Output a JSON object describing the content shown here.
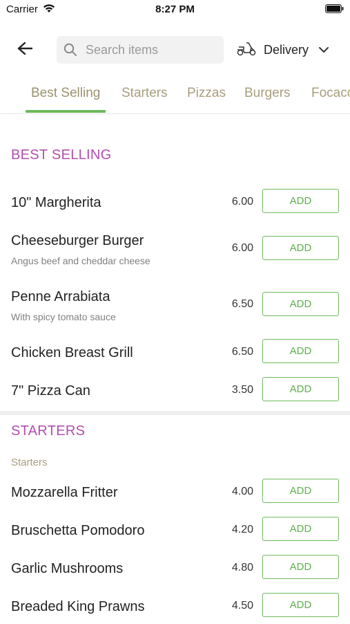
{
  "status_bar": {
    "carrier": "Carrier",
    "time": "8:27 PM"
  },
  "header": {
    "search_placeholder": "Search items",
    "delivery_label": "Delivery"
  },
  "tabs": [
    {
      "label": "Best Selling",
      "active": true
    },
    {
      "label": "Starters"
    },
    {
      "label": "Pizzas"
    },
    {
      "label": "Burgers"
    },
    {
      "label": "Focaccia"
    }
  ],
  "sections": [
    {
      "title": "BEST SELLING",
      "items": [
        {
          "name": "10\" Margherita",
          "desc": "",
          "price": "6.00",
          "button": "ADD"
        },
        {
          "name": "Cheeseburger Burger",
          "desc": "Angus beef and cheddar cheese",
          "price": "6.00",
          "button": "ADD"
        },
        {
          "name": "Penne Arrabiata",
          "desc": "With spicy tomato sauce",
          "price": "6.50",
          "button": "ADD"
        },
        {
          "name": "Chicken Breast Grill",
          "desc": "",
          "price": "6.50",
          "button": "ADD"
        },
        {
          "name": "7\" Pizza Can",
          "desc": "",
          "price": "3.50",
          "button": "ADD"
        }
      ]
    },
    {
      "title": "STARTERS",
      "subtitle": "Starters",
      "items": [
        {
          "name": "Mozzarella Fritter",
          "price": "4.00",
          "button": "ADD"
        },
        {
          "name": "Bruschetta Pomodoro",
          "price": "4.20",
          "button": "ADD"
        },
        {
          "name": "Garlic Mushrooms",
          "price": "4.80",
          "button": "ADD"
        },
        {
          "name": "Breaded King Prawns",
          "price": "4.50",
          "button": "ADD"
        }
      ]
    }
  ],
  "colors": {
    "accent": "#6cbb5a",
    "section_title": "#b24dae",
    "tab_text": "#a89d7d"
  },
  "icons": [
    "wifi-icon",
    "battery-icon",
    "back-arrow-icon",
    "search-icon",
    "scooter-icon",
    "chevron-down-icon"
  ]
}
